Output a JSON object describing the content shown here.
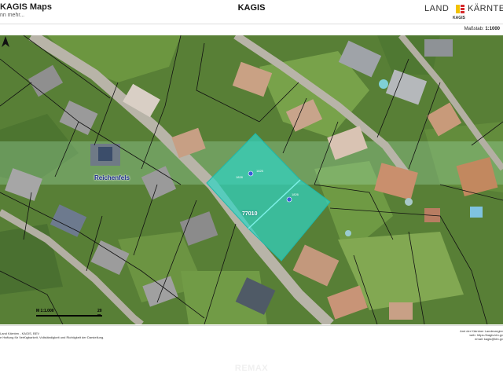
{
  "header": {
    "app_title": "KAGIS Maps",
    "app_subtitle": "nn mehr...",
    "center_title": "KAGIS",
    "logo_left": "LAND",
    "logo_right": "KÄRNTEN",
    "logo_sub": "KAGIS"
  },
  "scale": {
    "label": "Maßstab:",
    "value": "1:1000"
  },
  "map": {
    "place_label": "Reichenfels",
    "parcel_label": "77010",
    "parcel_numbers": [
      "1825",
      "1826",
      "1828"
    ],
    "scale_left": "M 1:1.000",
    "scale_right": "20 m",
    "parcel_color": "#2fd4c4",
    "highlight_band_color": "#9fd9a8"
  },
  "footer": {
    "left_line1": "Land Kärnten - KAGIS, BEV",
    "left_line2": "e Haftung für Verfügbarkeit, Vollständigkeit und Richtigkeit der Darstellung.",
    "right_line1": "Amt der Kärntner Landesregier",
    "right_line2": "web: https://kagis.ktn.gv",
    "right_line3": "email: kagis@ktn.gv"
  },
  "watermark": "REMAX"
}
